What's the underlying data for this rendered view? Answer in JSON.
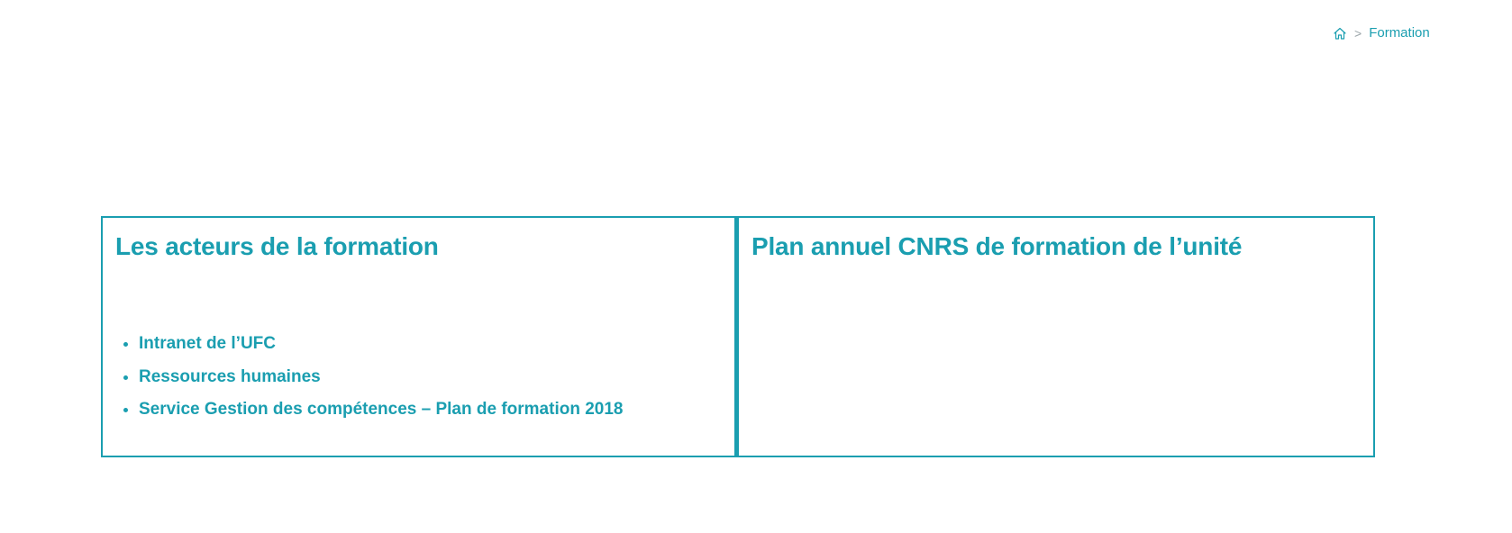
{
  "breadcrumb": {
    "home_icon": "home-icon",
    "separator": ">",
    "current": "Formation"
  },
  "colors": {
    "accent": "#1a9eb0",
    "separator": "#9aa4a8"
  },
  "boxes": {
    "left": {
      "title": "Les acteurs de la formation",
      "links": [
        "Intranet de l’UFC",
        "Ressources humaines",
        "Service Gestion des compétences – Plan de formation 2018"
      ]
    },
    "right": {
      "title": "Plan annuel CNRS de formation de l’unité"
    }
  }
}
